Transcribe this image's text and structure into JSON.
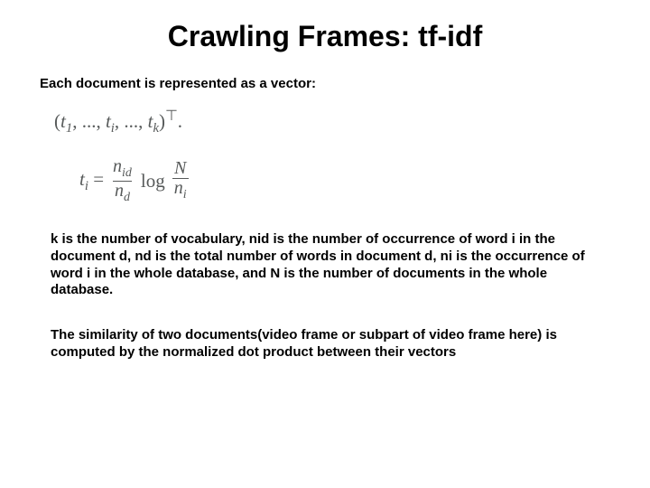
{
  "title": "Crawling Frames: tf-idf",
  "intro": "Each document is represented as a vector:",
  "formula_vector": {
    "left": "(",
    "t1": "t",
    "t1_sub": "1",
    "sep1": ", ..., ",
    "ti": "t",
    "ti_sub": "i",
    "sep2": ", ..., ",
    "tk": "t",
    "tk_sub": "k",
    "right": ")",
    "sup": "⊤",
    "tail": "."
  },
  "formula_ti": {
    "lhs_t": "t",
    "lhs_sub": "i",
    "eq": " = ",
    "num1_n": "n",
    "num1_sub": "id",
    "den1_n": "n",
    "den1_sub": "d",
    "log": " log ",
    "num2_N": "N",
    "den2_n": "n",
    "den2_sub": "i"
  },
  "para1": "k is the number of vocabulary, nid is the number of occurrence of word i in the document d, nd is the total number of words in document d, ni is the occurrence of word i in the whole database, and N is the number of documents in the whole database.",
  "para2": "The similarity of two documents(video frame or subpart of video frame here) is computed by the normalized dot product between their vectors"
}
